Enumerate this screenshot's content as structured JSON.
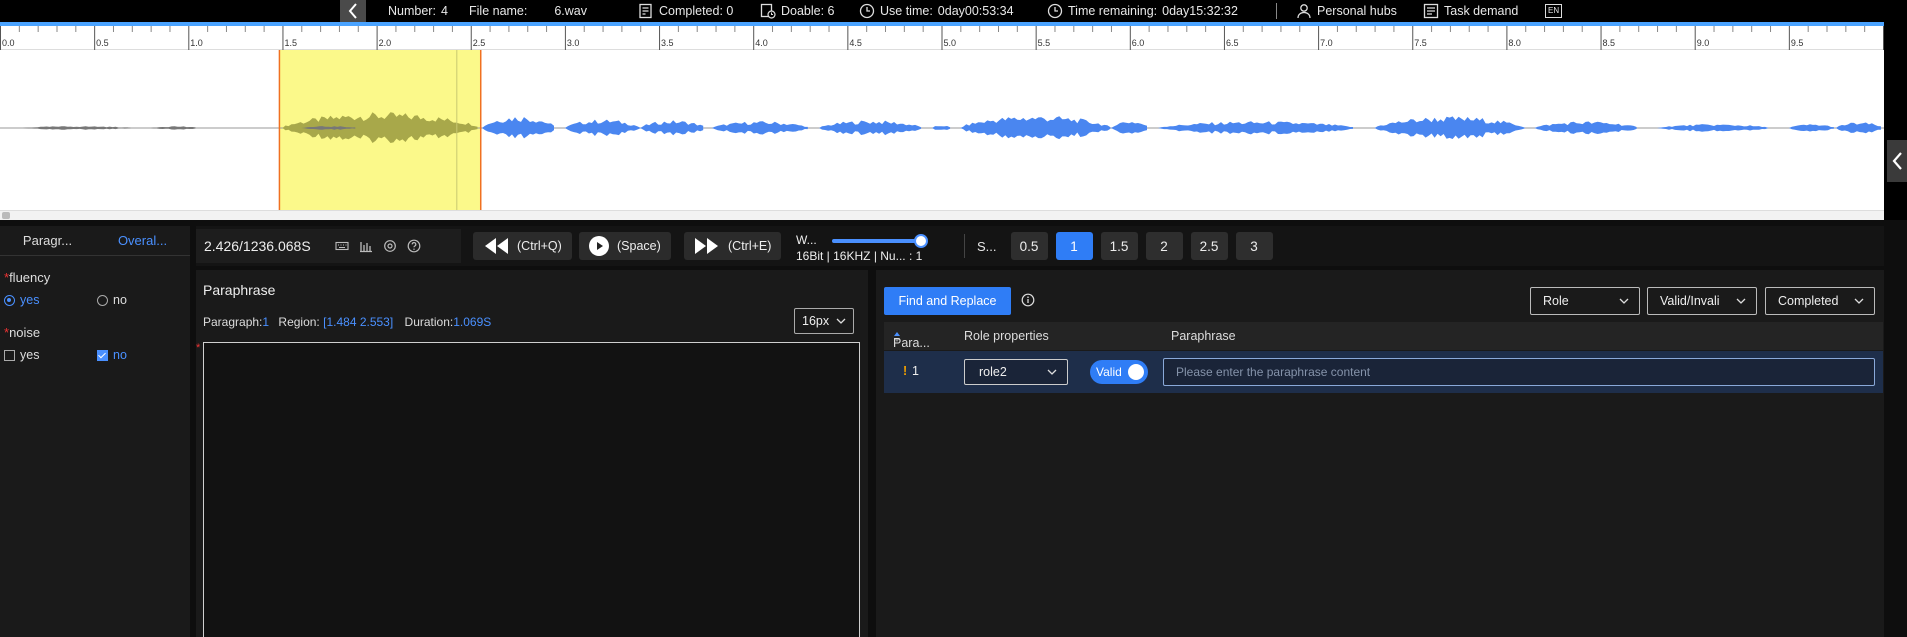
{
  "topbar": {
    "number_label": "Number:",
    "number_value": "4",
    "filename_label": "File name:",
    "filename_value": "6.wav",
    "completed": "Completed: 0",
    "doable": "Doable: 6",
    "use_time_label": "Use time:",
    "use_time_value": "0day00:53:34",
    "remaining_label": "Time remaining:",
    "remaining_value": "0day15:32:32",
    "personal_hubs": "Personal hubs",
    "task_demand": "Task demand",
    "lang": "EN"
  },
  "ruler": {
    "labels": [
      "0.0",
      "0.5",
      "1.0",
      "1.5",
      "2.0",
      "2.5",
      "3.0",
      "3.5",
      "4.0",
      "4.5",
      "5.0",
      "5.5",
      "6.0",
      "6.5",
      "7.0",
      "7.5",
      "8.0",
      "8.5",
      "9.0",
      "9.5"
    ]
  },
  "waveform": {
    "region_start_s": 1.484,
    "region_end_s": 2.553,
    "view_start_s": 0.0,
    "view_end_s": 9.9,
    "wave_color": "#4a86f0",
    "region_color": "#fbf98a"
  },
  "left_panel": {
    "tab_paragraph": "Paragr...",
    "tab_overall": "Overal...",
    "fluency_label": "fluency",
    "fluency_yes": "yes",
    "fluency_no": "no",
    "noise_label": "noise",
    "noise_yes": "yes",
    "noise_no": "no"
  },
  "controls": {
    "time": "2.426/1236.068S",
    "rewind_shortcut": "(Ctrl+Q)",
    "play_shortcut": "(Space)",
    "forward_shortcut": "(Ctrl+E)",
    "w_label": "W...",
    "audio_info": "16Bit | 16KHZ | Nu...  : 1",
    "speed_label": "S...",
    "speeds": [
      "0.5",
      "1",
      "1.5",
      "2",
      "2.5",
      "3"
    ],
    "active_speed": "1"
  },
  "paraphrase_panel": {
    "title": "Paraphrase",
    "paragraph_label": "Paragraph:",
    "paragraph_value": "1",
    "region_label": "Region:",
    "region_value": "[1.484   2.553]",
    "duration_label": "Duration:",
    "duration_value": "1.069S",
    "font_size": "16px"
  },
  "table_panel": {
    "find_replace": "Find and Replace",
    "filter_role": "Role",
    "filter_valid": "Valid/Invali",
    "filter_completed": "Completed",
    "col_para": "Para...",
    "col_role": "Role properties",
    "col_paraphrase": "Paraphrase",
    "row": {
      "index": "1",
      "warn": "!",
      "role": "role2",
      "valid": "Valid",
      "placeholder": "Please enter the paraphrase content"
    }
  }
}
